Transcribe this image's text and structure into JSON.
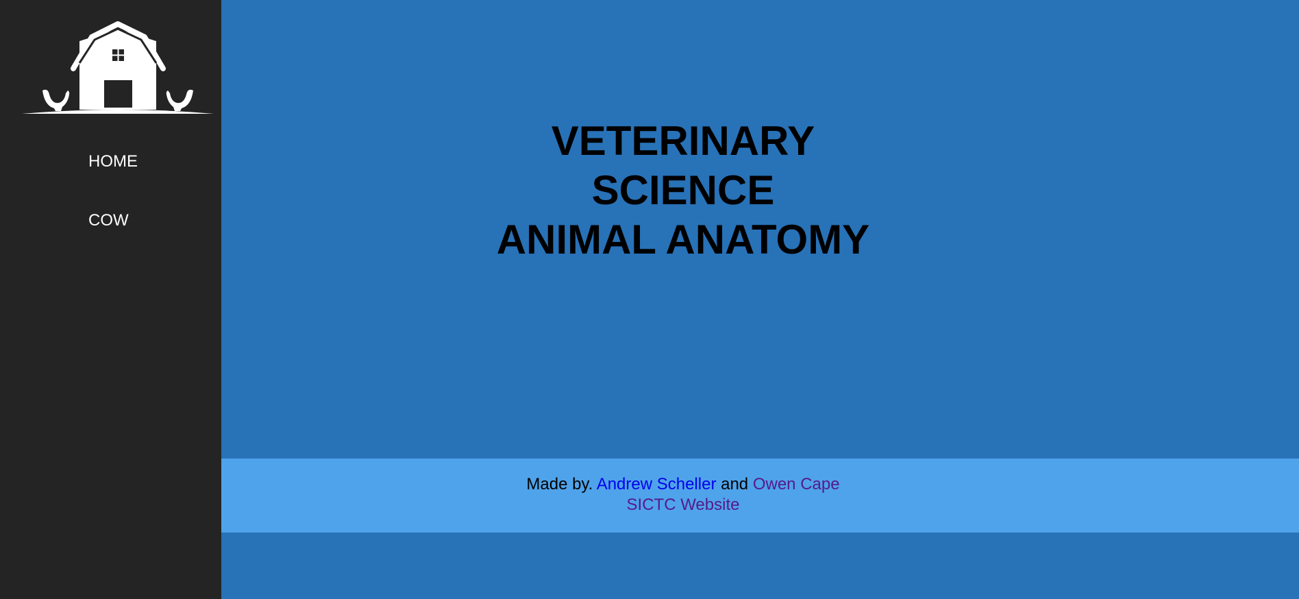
{
  "sidebar": {
    "logo": "barn-with-roosters-logo",
    "nav": [
      {
        "label": "HOME"
      },
      {
        "label": "COW"
      }
    ]
  },
  "main": {
    "title_lines": [
      "VETERINARY",
      "SCIENCE",
      "ANIMAL ANATOMY"
    ]
  },
  "footer": {
    "made_by": "Made by.",
    "author1": "Andrew Scheller",
    "and": "and",
    "author2": "Owen Cape",
    "website_link": "SICTC Website"
  },
  "colors": {
    "sidebar": "#242424",
    "main": "#2872b8",
    "footer": "#4fa3ea"
  }
}
